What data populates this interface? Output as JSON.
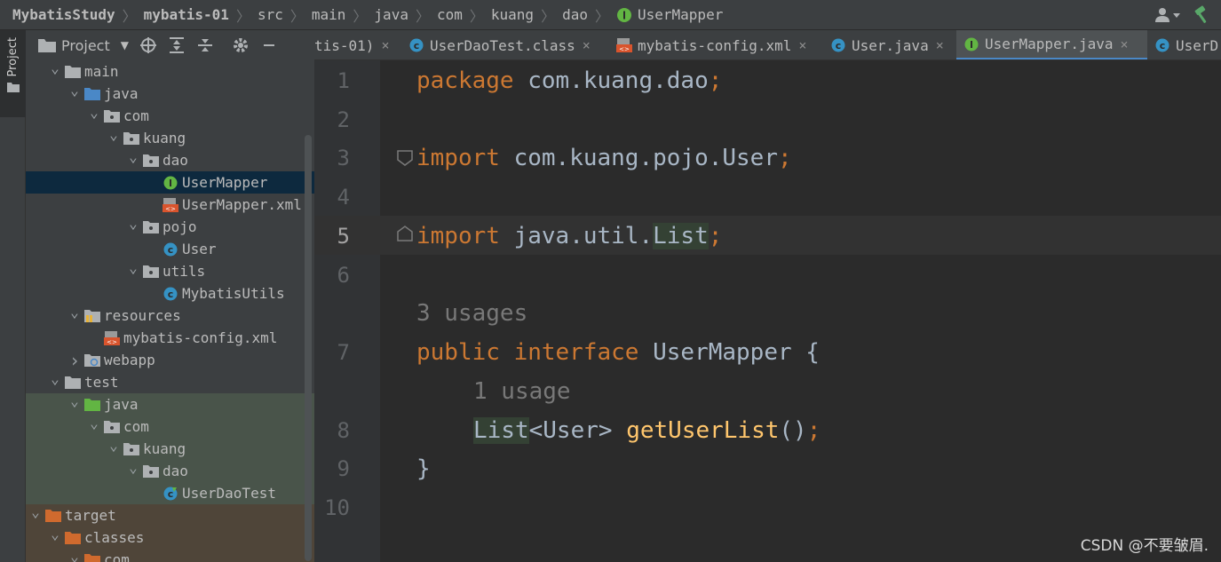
{
  "breadcrumb": [
    "MybatisStudy",
    "mybatis-01",
    "src",
    "main",
    "java",
    "com",
    "kuang",
    "dao",
    "UserMapper"
  ],
  "project_panel": {
    "title": "Project",
    "stripe_label": "Project"
  },
  "tree": [
    {
      "label": "main",
      "depth": 1,
      "arrow": "v",
      "icon": "folder"
    },
    {
      "label": "java",
      "depth": 2,
      "arrow": "v",
      "icon": "folder-blue"
    },
    {
      "label": "com",
      "depth": 3,
      "arrow": "v",
      "icon": "package"
    },
    {
      "label": "kuang",
      "depth": 4,
      "arrow": "v",
      "icon": "package"
    },
    {
      "label": "dao",
      "depth": 5,
      "arrow": "v",
      "icon": "package"
    },
    {
      "label": "UserMapper",
      "depth": 6,
      "arrow": "",
      "icon": "interface",
      "selected": true
    },
    {
      "label": "UserMapper.xml",
      "depth": 6,
      "arrow": "",
      "icon": "xml"
    },
    {
      "label": "pojo",
      "depth": 5,
      "arrow": "v",
      "icon": "package"
    },
    {
      "label": "User",
      "depth": 6,
      "arrow": "",
      "icon": "class"
    },
    {
      "label": "utils",
      "depth": 5,
      "arrow": "v",
      "icon": "package"
    },
    {
      "label": "MybatisUtils",
      "depth": 6,
      "arrow": "",
      "icon": "class"
    },
    {
      "label": "resources",
      "depth": 2,
      "arrow": "v",
      "icon": "folder-res"
    },
    {
      "label": "mybatis-config.xml",
      "depth": 3,
      "arrow": "",
      "icon": "xml"
    },
    {
      "label": "webapp",
      "depth": 2,
      "arrow": ">",
      "icon": "folder-web"
    },
    {
      "label": "test",
      "depth": 1,
      "arrow": "v",
      "icon": "folder"
    },
    {
      "label": "java",
      "depth": 2,
      "arrow": "v",
      "icon": "folder-green"
    },
    {
      "label": "com",
      "depth": 3,
      "arrow": "v",
      "icon": "package"
    },
    {
      "label": "kuang",
      "depth": 4,
      "arrow": "v",
      "icon": "package"
    },
    {
      "label": "dao",
      "depth": 5,
      "arrow": "v",
      "icon": "package"
    },
    {
      "label": "UserDaoTest",
      "depth": 6,
      "arrow": "",
      "icon": "test-class"
    },
    {
      "label": "target",
      "depth": 0,
      "arrow": "v",
      "icon": "folder-orange"
    },
    {
      "label": "classes",
      "depth": 1,
      "arrow": "v",
      "icon": "folder-orange"
    },
    {
      "label": "com",
      "depth": 2,
      "arrow": "v",
      "icon": "folder-orange"
    }
  ],
  "tabs": [
    {
      "label": "tis-01)",
      "icon": "",
      "active": false
    },
    {
      "label": "UserDaoTest.class",
      "icon": "class",
      "active": false
    },
    {
      "label": "mybatis-config.xml",
      "icon": "xml",
      "active": false
    },
    {
      "label": "User.java",
      "icon": "class",
      "active": false
    },
    {
      "label": "UserMapper.java",
      "icon": "interface",
      "active": true
    },
    {
      "label": "UserD",
      "icon": "class",
      "active": false
    }
  ],
  "code": {
    "line_numbers": [
      "1",
      "2",
      "3",
      "4",
      "5",
      "6",
      "7",
      "8",
      "9",
      "10"
    ],
    "l1_kw": "package",
    "l1_rest": " com.kuang.dao",
    "l3_kw": "import",
    "l3_rest": " com.kuang.pojo.User",
    "l5_kw": "import",
    "l5_rest": " java.util.",
    "l5_hl": "List",
    "hint_usages_class": "3 usages",
    "l7_kw": "public interface",
    "l7_rest": " UserMapper {",
    "hint_usages_method": "1 usage",
    "l8_type": "List",
    "l8_generic": "<User> ",
    "l8_method": "getUserList",
    "l8_paren": "()",
    "l9": "}",
    "semicolon": ";"
  },
  "watermark": "CSDN @不要皱眉."
}
